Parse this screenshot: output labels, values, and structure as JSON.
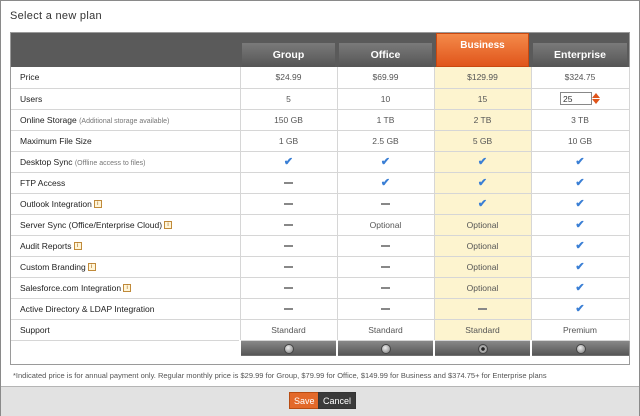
{
  "dialog": {
    "title": "Select a new plan",
    "footnote": "*Indicated price is for annual payment only. Regular monthly price is $29.99 for Group, $79.99 for Office, $149.99 for Business and $374.75+ for Enterprise plans",
    "save_label": "Save",
    "cancel_label": "Cancel"
  },
  "plans": [
    "Group",
    "Office",
    "Business",
    "Enterprise"
  ],
  "selected_plan": "Business",
  "colors": {
    "accent": "#e0551b",
    "highlight_column": "#fdf4cf",
    "check": "#3a7fd5",
    "header": "#5a5a5a"
  },
  "rows": [
    {
      "label": "Price",
      "note": "",
      "info": false,
      "cells": [
        "$24.99",
        "$69.99",
        "$129.99",
        "$324.75"
      ]
    },
    {
      "label": "Users",
      "note": "",
      "info": false,
      "cells": [
        "5",
        "10",
        "15",
        "input:25"
      ]
    },
    {
      "label": "Online Storage",
      "note": "(Additional storage available)",
      "info": false,
      "cells": [
        "150 GB",
        "1 TB",
        "2 TB",
        "3 TB"
      ]
    },
    {
      "label": "Maximum File Size",
      "note": "",
      "info": false,
      "cells": [
        "1 GB",
        "2.5 GB",
        "5 GB",
        "10 GB"
      ]
    },
    {
      "label": "Desktop Sync",
      "note": "(Offline access to files)",
      "info": false,
      "cells": [
        "check",
        "check",
        "check",
        "check"
      ]
    },
    {
      "label": "FTP Access",
      "note": "",
      "info": false,
      "cells": [
        "dash",
        "check",
        "check",
        "check"
      ]
    },
    {
      "label": "Outlook Integration",
      "note": "",
      "info": true,
      "cells": [
        "dash",
        "dash",
        "check",
        "check"
      ]
    },
    {
      "label": "Server Sync (Office/Enterprise Cloud)",
      "note": "",
      "info": true,
      "cells": [
        "dash",
        "Optional",
        "Optional",
        "check"
      ]
    },
    {
      "label": "Audit Reports",
      "note": "",
      "info": true,
      "cells": [
        "dash",
        "dash",
        "Optional",
        "check"
      ]
    },
    {
      "label": "Custom Branding",
      "note": "",
      "info": true,
      "cells": [
        "dash",
        "dash",
        "Optional",
        "check"
      ]
    },
    {
      "label": "Salesforce.com Integration",
      "note": "",
      "info": true,
      "cells": [
        "dash",
        "dash",
        "Optional",
        "check"
      ]
    },
    {
      "label": "Active Directory & LDAP Integration",
      "note": "",
      "info": false,
      "cells": [
        "dash",
        "dash",
        "dash",
        "check"
      ]
    },
    {
      "label": "Support",
      "note": "",
      "info": false,
      "cells": [
        "Standard",
        "Standard",
        "Standard",
        "Premium"
      ]
    }
  ]
}
